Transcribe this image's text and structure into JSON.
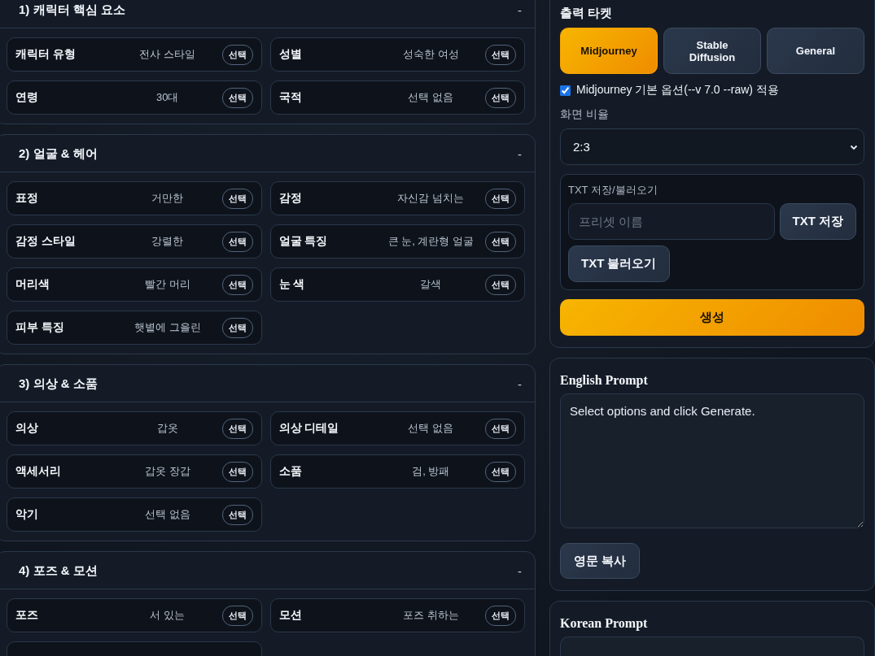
{
  "sections": [
    {
      "title": "1) 캐릭터 핵심 요소",
      "toggle": "-",
      "fields": [
        {
          "label": "캐릭터 유형",
          "value": "전사 스타일",
          "button": "선택"
        },
        {
          "label": "성별",
          "value": "성숙한 여성",
          "button": "선택"
        },
        {
          "label": "연령",
          "value": "30대",
          "button": "선택"
        },
        {
          "label": "국적",
          "value": "선택 없음",
          "button": "선택"
        }
      ]
    },
    {
      "title": "2) 얼굴 & 헤어",
      "toggle": "-",
      "fields": [
        {
          "label": "표정",
          "value": "거만한",
          "button": "선택"
        },
        {
          "label": "감정",
          "value": "자신감 넘치는",
          "button": "선택"
        },
        {
          "label": "감정 스타일",
          "value": "강렬한",
          "button": "선택"
        },
        {
          "label": "얼굴 특징",
          "value": "큰 눈, 계란형 얼굴",
          "button": "선택"
        },
        {
          "label": "머리색",
          "value": "빨간 머리",
          "button": "선택"
        },
        {
          "label": "눈 색",
          "value": "갈색",
          "button": "선택"
        },
        {
          "label": "피부 특징",
          "value": "햇볕에 그을린",
          "button": "선택"
        }
      ]
    },
    {
      "title": "3) 의상 & 소품",
      "toggle": "-",
      "fields": [
        {
          "label": "의상",
          "value": "갑옷",
          "button": "선택"
        },
        {
          "label": "의상 디테일",
          "value": "선택 없음",
          "button": "선택"
        },
        {
          "label": "액세서리",
          "value": "갑옷 장갑",
          "button": "선택"
        },
        {
          "label": "소품",
          "value": "검, 방패",
          "button": "선택"
        },
        {
          "label": "악기",
          "value": "선택 없음",
          "button": "선택"
        }
      ]
    },
    {
      "title": "4) 포즈 & 모션",
      "toggle": "-",
      "fields": [
        {
          "label": "포즈",
          "value": "서 있는",
          "button": "선택"
        },
        {
          "label": "모션",
          "value": "포즈 취하는",
          "button": "선택"
        },
        {
          "kind": "cut"
        }
      ]
    }
  ],
  "output": {
    "title": "출력 타켓",
    "targets": [
      {
        "label": "Midjourney",
        "selected": true
      },
      {
        "label": "Stable Diffusion",
        "selected": false
      },
      {
        "label": "General",
        "selected": false
      }
    ],
    "mj_option": {
      "label": "Midjourney 기본 옵션(--v 7.0 --raw) 적용",
      "checked": true
    },
    "aspect": {
      "label": "화면 비율",
      "value": "2:3"
    },
    "txt_io": {
      "title": "TXT 저장/불러오기",
      "placeholder": "프리셋 이름",
      "save_button": "TXT 저장",
      "load_button": "TXT 불러오기"
    },
    "generate_button": "생성"
  },
  "english_prompt": {
    "title": "English Prompt",
    "value": "Select options and click Generate.",
    "copy_button": "영문 복사"
  },
  "korean_prompt": {
    "title": "Korean Prompt"
  }
}
